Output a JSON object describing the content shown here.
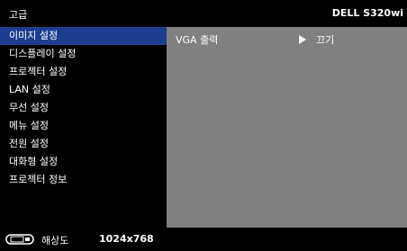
{
  "header": {
    "menu_title": "고급",
    "model": "DELL S320wi"
  },
  "sidebar": {
    "items": [
      {
        "label": "이미지 설정",
        "selected": true
      },
      {
        "label": "디스플레이 설정",
        "selected": false
      },
      {
        "label": "프로젝터 설정",
        "selected": false
      },
      {
        "label": "LAN 설정",
        "selected": false
      },
      {
        "label": "무선 설정",
        "selected": false
      },
      {
        "label": "메뉴 설정",
        "selected": false
      },
      {
        "label": "전원 설정",
        "selected": false
      },
      {
        "label": "대화형 설정",
        "selected": false
      },
      {
        "label": "프로젝터 정보",
        "selected": false
      }
    ]
  },
  "panel": {
    "option_label": "VGA 출력",
    "option_arrow_icon": "play-right-icon",
    "option_value": "끄기"
  },
  "status": {
    "icon": "monitor-resolution-icon",
    "resolution_label": "해상도",
    "resolution_value": "1024x768"
  },
  "colors": {
    "selected_bg": "#1c3e90",
    "panel_bg": "#808080",
    "background": "#000000",
    "text": "#ffffff"
  }
}
